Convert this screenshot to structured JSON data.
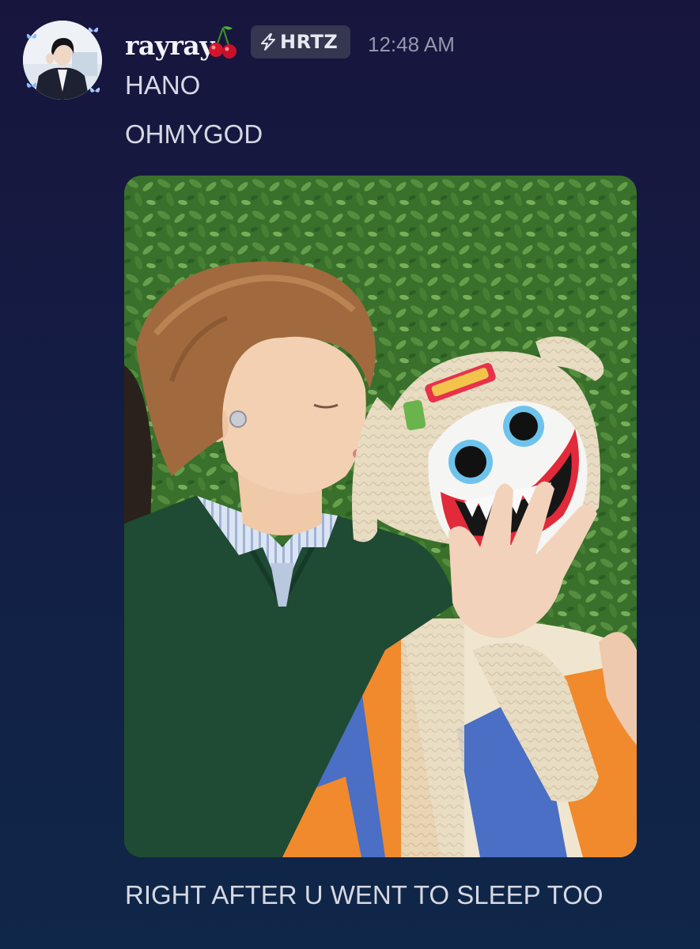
{
  "message": {
    "author": {
      "name": "rayray",
      "emoji": "cherry-emoji",
      "avatar": "user-avatar"
    },
    "tag": {
      "icon": "lightning-icon",
      "label": "HRTZ"
    },
    "timestamp": "12:48 AM",
    "lines": [
      "HANO",
      "OHMYGOD"
    ],
    "attachment": {
      "type": "image",
      "name": "photo-attachment"
    },
    "caption": "RIGHT AFTER U WENT TO SLEEP TOO"
  },
  "colors": {
    "background_top": "#17153d",
    "background_bottom": "#0f2748",
    "tag_background": "#34374f",
    "text": "#d6d8e4",
    "timestamp": "#9498ad"
  }
}
